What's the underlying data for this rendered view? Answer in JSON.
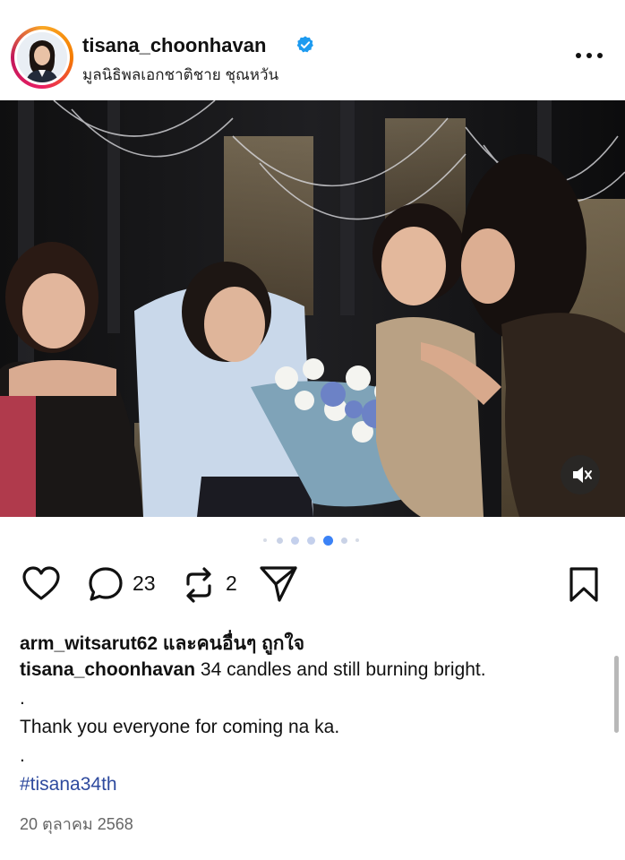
{
  "post": {
    "username": "tisana_choonhavan",
    "subtitle": "มูลนิธิพลเอกชาติชาย ชุณหวัน",
    "verified": true,
    "comments_count": "23",
    "reposts_count": "2",
    "likes_prefix": "arm_witsarut62",
    "likes_suffix": " และคนอื่นๆ ถูกใจ",
    "caption_user": "tisana_choonhavan",
    "caption_text": " 34 candles and still burning bright.",
    "caption_dot1": ".",
    "caption_line2": "Thank you everyone for coming na ka.",
    "caption_dot2": ".",
    "hashtag": "#tisana34th",
    "date": "20 ตุลาคม 2568",
    "carousel_total": 7,
    "carousel_active": 4
  },
  "icons": [
    "verified-badge-icon",
    "more-options-icon",
    "heart-icon",
    "comment-icon",
    "repost-icon",
    "share-icon",
    "bookmark-icon",
    "mute-icon"
  ],
  "colors": {
    "verified": "#1d9bf0",
    "active_dot": "#3b82f6",
    "hashtag": "#2e4a9e"
  }
}
